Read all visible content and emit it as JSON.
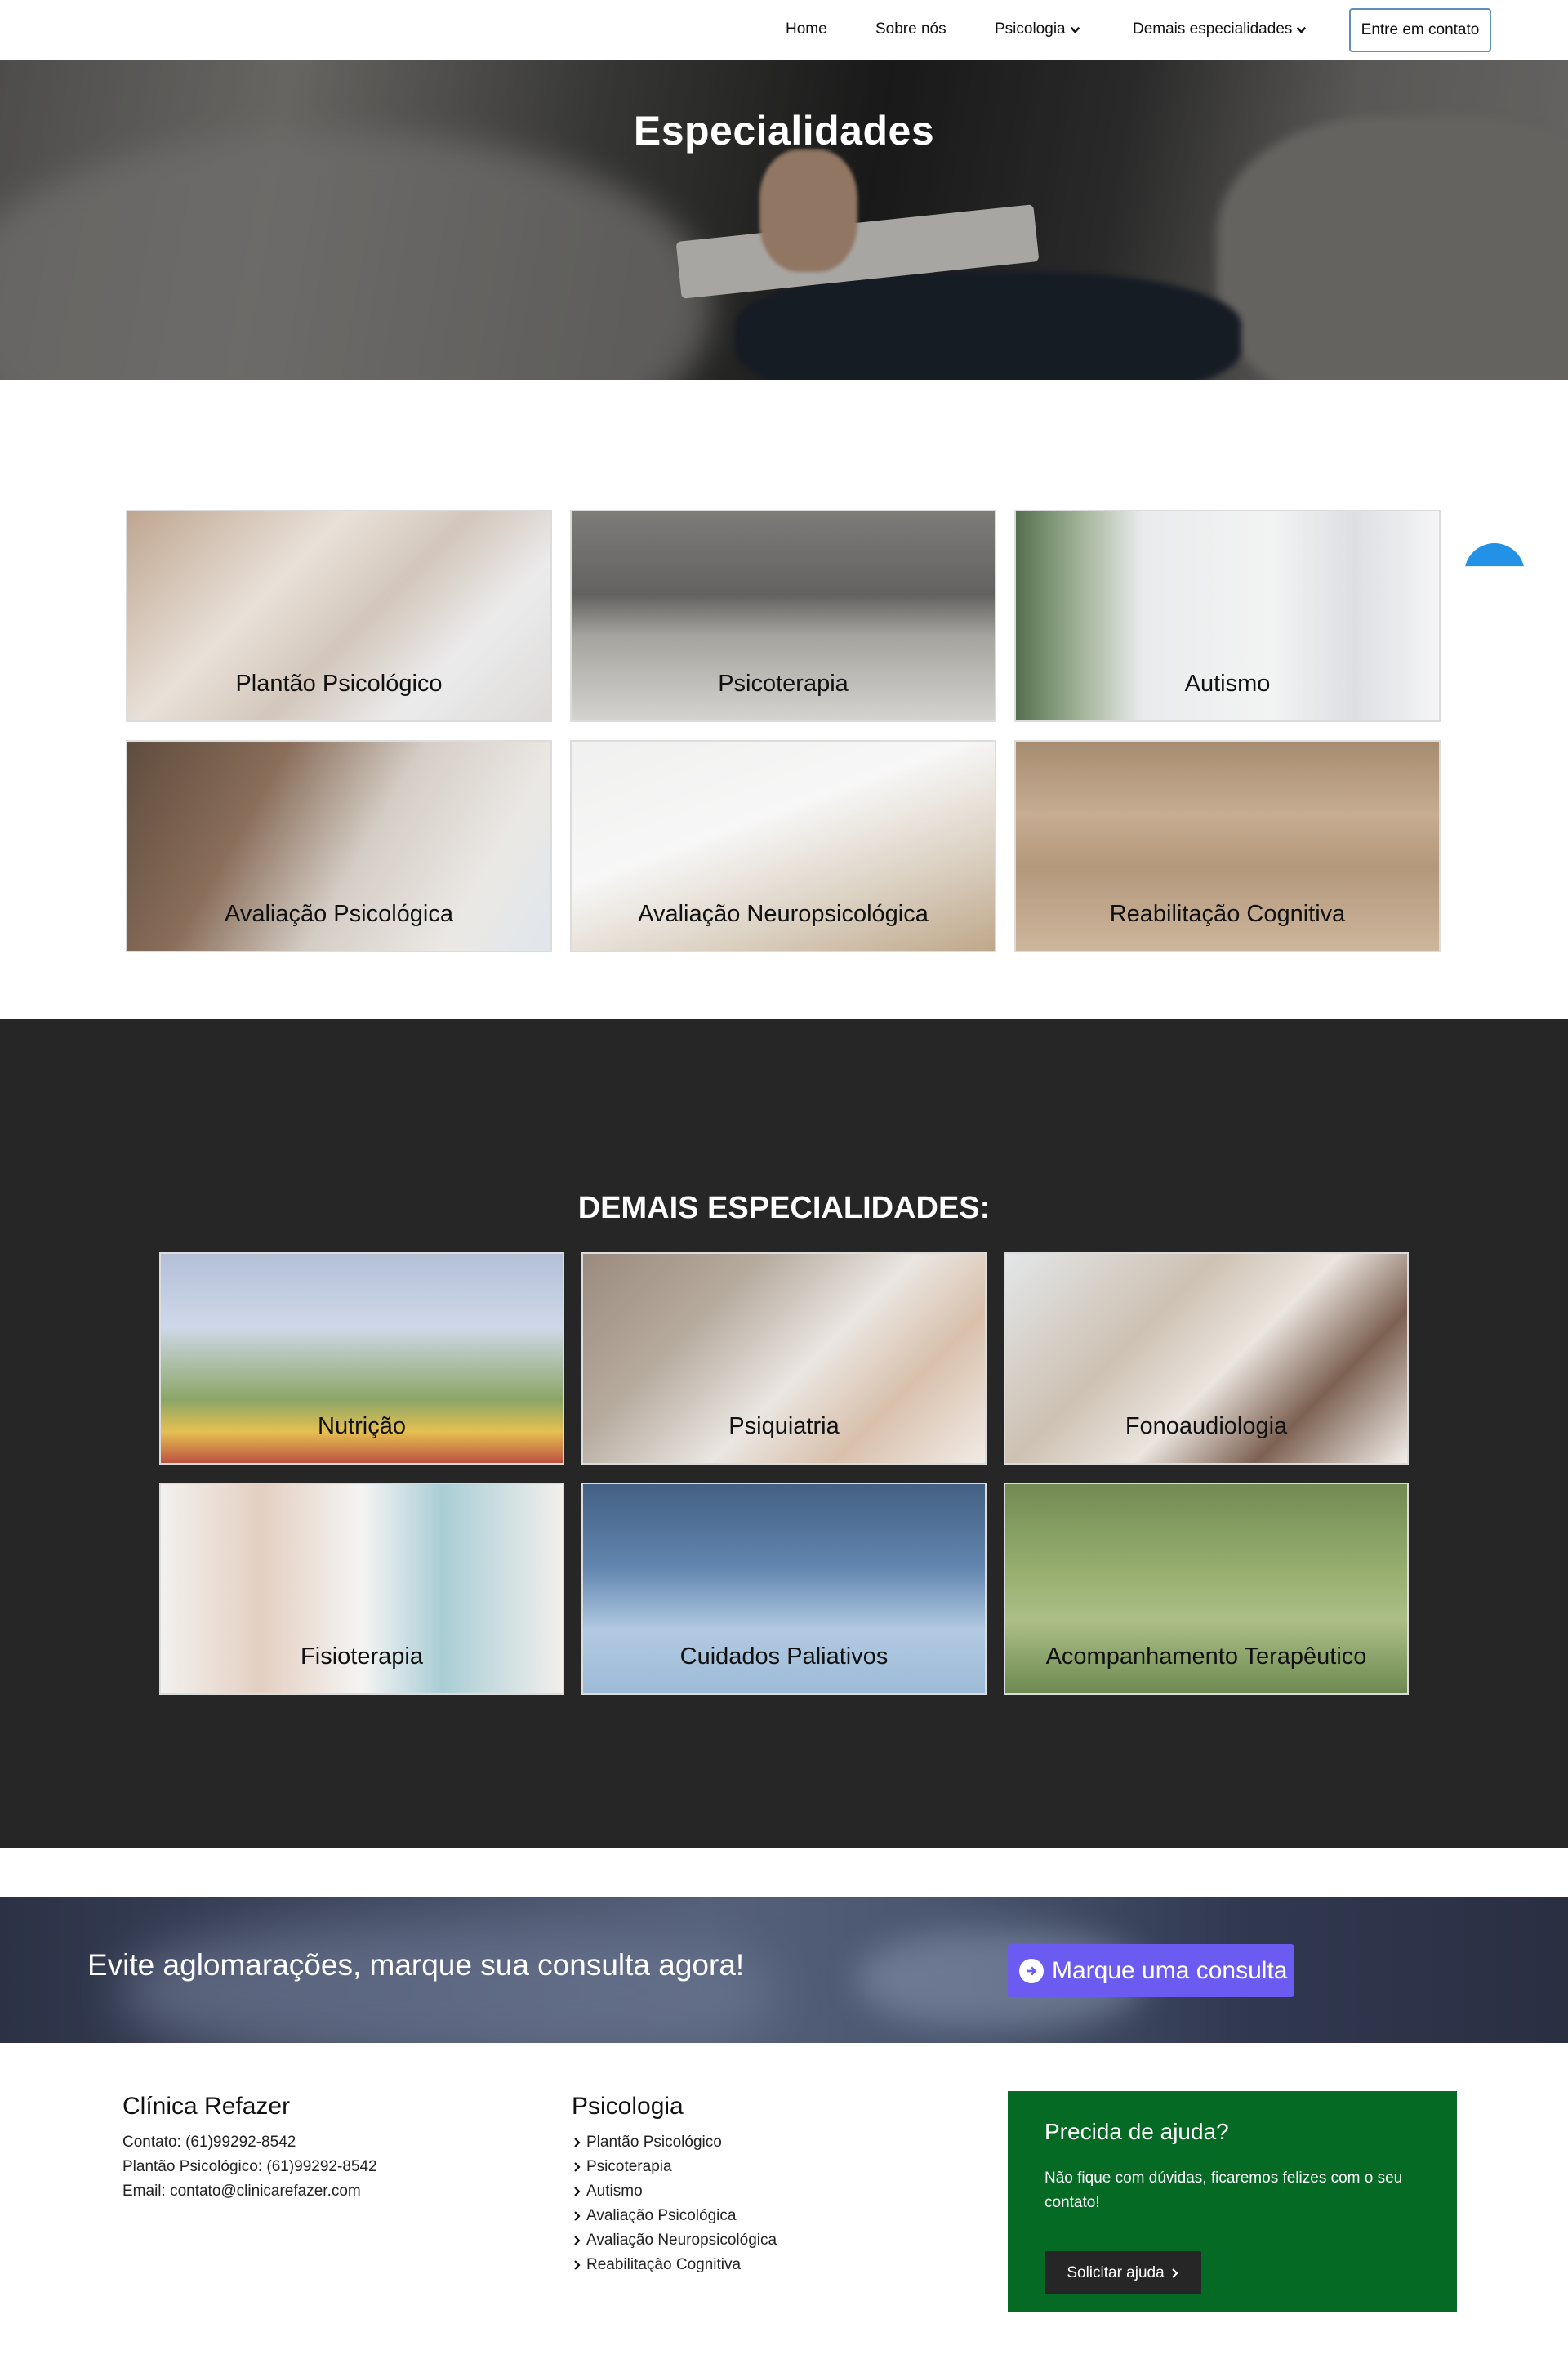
{
  "nav": {
    "home": "Home",
    "about": "Sobre nós",
    "psicologia": "Psicologia",
    "demais": "Demais especialidades",
    "contact": "Entre em contato"
  },
  "hero": {
    "title": "Especialidades"
  },
  "specialties": [
    "Plantão Psicológico",
    "Psicoterapia",
    "Autismo",
    "Avaliação Psicológica",
    "Avaliação Neuropsicológica",
    "Reabilitação Cognitiva"
  ],
  "other": {
    "title": "DEMAIS ESPECIALIDADES:",
    "items": [
      "Nutrição",
      "Psiquiatria",
      "Fonoaudiologia",
      "Fisioterapia",
      "Cuidados Paliativos",
      "Acompanhamento Terapêutico"
    ]
  },
  "cta": {
    "text": "Evite aglomarações, marque sua consulta agora!",
    "button": "Marque uma consulta"
  },
  "footer": {
    "clinic": {
      "title": "Clínica Refazer",
      "lines": [
        "Contato: (61)99292-8542",
        "Plantão Psicológico: (61)99292-8542",
        "Email: contato@clinicarefazer.com"
      ]
    },
    "psicologia": {
      "title": "Psicologia",
      "links": [
        "Plantão Psicológico",
        "Psicoterapia",
        "Autismo",
        "Avaliação Psicológica",
        "Avaliação Neuropsicológica",
        "Reabilitação Cognitiva"
      ]
    },
    "help": {
      "title": "Precida de ajuda?",
      "text": "Não fique com dúvidas, ficaremos felizes com o seu contato!",
      "button": "Solicitar ajuda"
    }
  },
  "colors": {
    "dark_section": "#262626",
    "cta_button": "#6c5bf0",
    "help_box": "#046a24",
    "float_button": "#2391e6"
  }
}
